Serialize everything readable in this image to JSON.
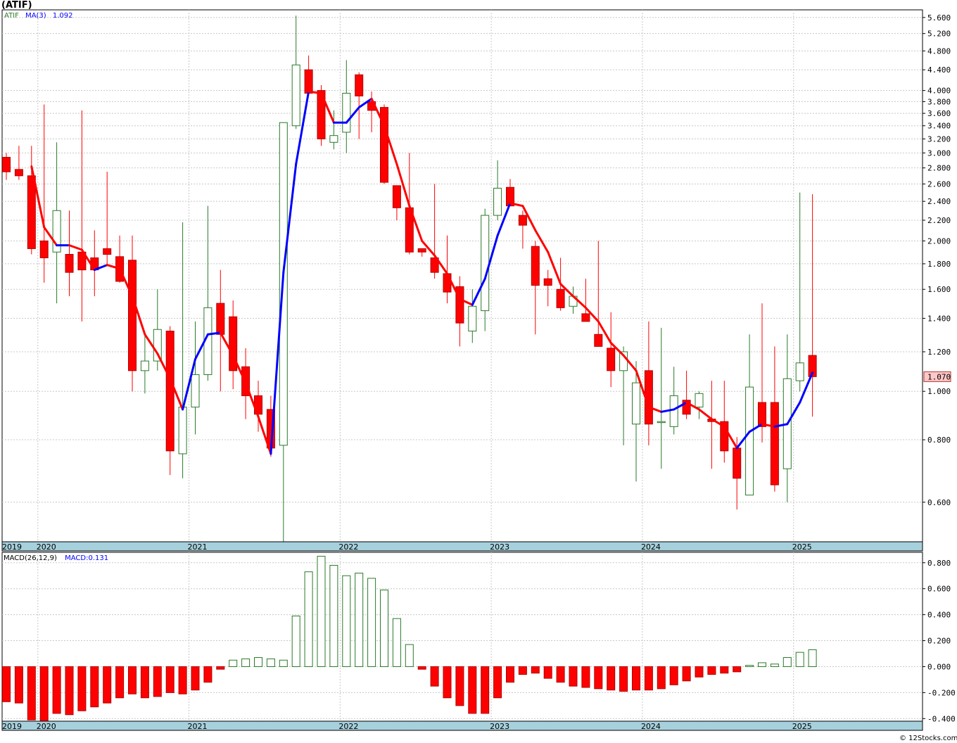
{
  "title": "(ATIF)",
  "footer": "© 12Stocks.com",
  "price_panel": {
    "ticker": "ATIF",
    "ma_label": "MA(3)",
    "ma_value": "1.092",
    "last_price": "1.070",
    "y_ticks": [
      {
        "v": 5.6,
        "label": "5.600"
      },
      {
        "v": 5.2,
        "label": "5.200"
      },
      {
        "v": 4.8,
        "label": "4.800"
      },
      {
        "v": 4.4,
        "label": "4.400"
      },
      {
        "v": 4.0,
        "label": "4.000"
      },
      {
        "v": 3.8,
        "label": "3.800"
      },
      {
        "v": 3.6,
        "label": "3.600"
      },
      {
        "v": 3.4,
        "label": "3.400"
      },
      {
        "v": 3.2,
        "label": "3.200"
      },
      {
        "v": 3.0,
        "label": "3.000"
      },
      {
        "v": 2.8,
        "label": "2.800"
      },
      {
        "v": 2.6,
        "label": "2.600"
      },
      {
        "v": 2.4,
        "label": "2.400"
      },
      {
        "v": 2.2,
        "label": "2.200"
      },
      {
        "v": 2.0,
        "label": "2.000"
      },
      {
        "v": 1.8,
        "label": "1.800"
      },
      {
        "v": 1.6,
        "label": "1.600"
      },
      {
        "v": 1.4,
        "label": "1.400"
      },
      {
        "v": 1.2,
        "label": "1.200"
      },
      {
        "v": 1.0,
        "label": "1.000"
      },
      {
        "v": 0.8,
        "label": "0.800"
      },
      {
        "v": 0.6,
        "label": "0.600"
      }
    ]
  },
  "macd_panel": {
    "label": "MACD(26,12,9)",
    "value_label": "MACD:0.131",
    "y_ticks": [
      {
        "v": 0.8,
        "label": "0.800"
      },
      {
        "v": 0.6,
        "label": "0.600"
      },
      {
        "v": 0.4,
        "label": "0.400"
      },
      {
        "v": 0.2,
        "label": "0.200"
      },
      {
        "v": 0.0,
        "label": "0.000"
      },
      {
        "v": -0.2,
        "label": "-0.200"
      },
      {
        "v": -0.4,
        "label": "-0.400"
      }
    ]
  },
  "colors": {
    "up": "#2a7a2a",
    "down": "#ff0000",
    "ma_up": "#0000ff",
    "ma_down": "#ff0000",
    "grid": "#c8c8c8",
    "axis_band": "#a6d0dc",
    "last_bg": "#ffc8c8"
  },
  "chart_data": {
    "type": "candlestick",
    "interval": "monthly",
    "scale": "log",
    "ylim": [
      0.5,
      5.8
    ],
    "macd_ylim": [
      -0.42,
      0.88
    ],
    "x_labels": [
      {
        "i": 0,
        "label": "2019"
      },
      {
        "i": 3,
        "label": "2020"
      },
      {
        "i": 15,
        "label": "2021"
      },
      {
        "i": 27,
        "label": "2022"
      },
      {
        "i": 39,
        "label": "2023"
      },
      {
        "i": 51,
        "label": "2024"
      },
      {
        "i": 63,
        "label": "2025"
      }
    ],
    "candles": [
      {
        "date": "2019-10",
        "o": 2.94,
        "h": 3.0,
        "l": 2.65,
        "c": 2.75
      },
      {
        "date": "2019-11",
        "o": 2.78,
        "h": 3.1,
        "l": 2.65,
        "c": 2.7
      },
      {
        "date": "2019-12",
        "o": 2.7,
        "h": 3.1,
        "l": 1.88,
        "c": 1.93
      },
      {
        "date": "2020-01",
        "o": 2.0,
        "h": 3.75,
        "l": 1.65,
        "c": 1.85
      },
      {
        "date": "2020-02",
        "o": 1.9,
        "h": 3.15,
        "l": 1.5,
        "c": 2.3
      },
      {
        "date": "2020-03",
        "o": 1.88,
        "h": 2.3,
        "l": 1.55,
        "c": 1.73
      },
      {
        "date": "2020-04",
        "o": 1.9,
        "h": 3.65,
        "l": 1.38,
        "c": 1.75
      },
      {
        "date": "2020-05",
        "o": 1.85,
        "h": 2.1,
        "l": 1.55,
        "c": 1.75
      },
      {
        "date": "2020-06",
        "o": 1.93,
        "h": 2.75,
        "l": 1.78,
        "c": 1.88
      },
      {
        "date": "2020-07",
        "o": 1.86,
        "h": 2.05,
        "l": 1.65,
        "c": 1.66
      },
      {
        "date": "2020-08",
        "o": 1.83,
        "h": 2.05,
        "l": 1.0,
        "c": 1.1
      },
      {
        "date": "2020-09",
        "o": 1.1,
        "h": 1.3,
        "l": 0.99,
        "c": 1.15
      },
      {
        "date": "2020-10",
        "o": 1.15,
        "h": 1.6,
        "l": 1.1,
        "c": 1.33
      },
      {
        "date": "2020-11",
        "o": 1.32,
        "h": 1.35,
        "l": 0.68,
        "c": 0.76
      },
      {
        "date": "2020-12",
        "o": 0.75,
        "h": 2.18,
        "l": 0.67,
        "c": 0.93
      },
      {
        "date": "2021-01",
        "o": 0.93,
        "h": 1.38,
        "l": 0.82,
        "c": 1.08
      },
      {
        "date": "2021-02",
        "o": 1.08,
        "h": 2.35,
        "l": 1.05,
        "c": 1.47
      },
      {
        "date": "2021-03",
        "o": 1.5,
        "h": 1.75,
        "l": 1.0,
        "c": 1.3
      },
      {
        "date": "2021-04",
        "o": 1.41,
        "h": 1.52,
        "l": 1.01,
        "c": 1.1
      },
      {
        "date": "2021-05",
        "o": 1.12,
        "h": 1.22,
        "l": 0.88,
        "c": 0.98
      },
      {
        "date": "2021-06",
        "o": 0.98,
        "h": 1.05,
        "l": 0.83,
        "c": 0.9
      },
      {
        "date": "2021-07",
        "o": 0.92,
        "h": 0.98,
        "l": 0.74,
        "c": 0.77
      },
      {
        "date": "2021-08",
        "o": 0.78,
        "h": 3.45,
        "l": 0.48,
        "c": 3.45
      },
      {
        "date": "2021-09",
        "o": 3.4,
        "h": 5.65,
        "l": 3.35,
        "c": 4.5
      },
      {
        "date": "2021-10",
        "o": 4.4,
        "h": 4.7,
        "l": 3.9,
        "c": 3.95
      },
      {
        "date": "2021-11",
        "o": 4.0,
        "h": 4.1,
        "l": 3.1,
        "c": 3.2
      },
      {
        "date": "2021-12",
        "o": 3.15,
        "h": 3.65,
        "l": 3.05,
        "c": 3.25
      },
      {
        "date": "2022-01",
        "o": 3.3,
        "h": 4.6,
        "l": 3.0,
        "c": 3.95
      },
      {
        "date": "2022-02",
        "o": 4.3,
        "h": 4.35,
        "l": 3.2,
        "c": 3.9
      },
      {
        "date": "2022-03",
        "o": 3.8,
        "h": 3.98,
        "l": 3.3,
        "c": 3.65
      },
      {
        "date": "2022-04",
        "o": 3.7,
        "h": 3.75,
        "l": 2.6,
        "c": 2.62
      },
      {
        "date": "2022-05",
        "o": 2.58,
        "h": 2.58,
        "l": 2.2,
        "c": 2.33
      },
      {
        "date": "2022-06",
        "o": 2.33,
        "h": 3.0,
        "l": 1.88,
        "c": 1.9
      },
      {
        "date": "2022-07",
        "o": 1.93,
        "h": 1.93,
        "l": 1.86,
        "c": 1.9
      },
      {
        "date": "2022-08",
        "o": 1.85,
        "h": 2.6,
        "l": 1.68,
        "c": 1.73
      },
      {
        "date": "2022-09",
        "o": 1.72,
        "h": 2.05,
        "l": 1.5,
        "c": 1.58
      },
      {
        "date": "2022-10",
        "o": 1.62,
        "h": 1.7,
        "l": 1.23,
        "c": 1.37
      },
      {
        "date": "2022-11",
        "o": 1.32,
        "h": 1.6,
        "l": 1.25,
        "c": 1.48
      },
      {
        "date": "2022-12",
        "o": 1.45,
        "h": 2.32,
        "l": 1.32,
        "c": 2.25
      },
      {
        "date": "2023-01",
        "o": 2.25,
        "h": 2.9,
        "l": 2.2,
        "c": 2.55
      },
      {
        "date": "2023-02",
        "o": 2.56,
        "h": 2.66,
        "l": 2.35,
        "c": 2.35
      },
      {
        "date": "2023-03",
        "o": 2.25,
        "h": 2.3,
        "l": 1.93,
        "c": 2.15
      },
      {
        "date": "2023-04",
        "o": 1.95,
        "h": 2.0,
        "l": 1.3,
        "c": 1.63
      },
      {
        "date": "2023-05",
        "o": 1.68,
        "h": 1.75,
        "l": 1.48,
        "c": 1.63
      },
      {
        "date": "2023-06",
        "o": 1.6,
        "h": 1.85,
        "l": 1.45,
        "c": 1.47
      },
      {
        "date": "2023-07",
        "o": 1.48,
        "h": 1.62,
        "l": 1.43,
        "c": 1.55
      },
      {
        "date": "2023-08",
        "o": 1.43,
        "h": 1.68,
        "l": 1.38,
        "c": 1.38
      },
      {
        "date": "2023-09",
        "o": 1.3,
        "h": 2.0,
        "l": 1.23,
        "c": 1.23
      },
      {
        "date": "2023-10",
        "o": 1.22,
        "h": 1.44,
        "l": 1.02,
        "c": 1.1
      },
      {
        "date": "2023-11",
        "o": 1.1,
        "h": 1.23,
        "l": 0.78,
        "c": 1.2
      },
      {
        "date": "2023-12",
        "o": 0.86,
        "h": 1.15,
        "l": 0.66,
        "c": 1.04
      },
      {
        "date": "2024-01",
        "o": 1.1,
        "h": 1.38,
        "l": 0.78,
        "c": 0.86
      },
      {
        "date": "2024-02",
        "o": 0.87,
        "h": 1.34,
        "l": 0.7,
        "c": 0.87
      },
      {
        "date": "2024-03",
        "o": 0.85,
        "h": 1.12,
        "l": 0.82,
        "c": 0.98
      },
      {
        "date": "2024-04",
        "o": 0.96,
        "h": 1.1,
        "l": 0.88,
        "c": 0.9
      },
      {
        "date": "2024-05",
        "o": 0.93,
        "h": 1.0,
        "l": 0.88,
        "c": 0.99
      },
      {
        "date": "2024-06",
        "o": 0.88,
        "h": 1.05,
        "l": 0.7,
        "c": 0.87
      },
      {
        "date": "2024-07",
        "o": 0.87,
        "h": 1.05,
        "l": 0.72,
        "c": 0.76
      },
      {
        "date": "2024-08",
        "o": 0.77,
        "h": 0.81,
        "l": 0.58,
        "c": 0.67
      },
      {
        "date": "2024-09",
        "o": 0.62,
        "h": 1.3,
        "l": 0.62,
        "c": 1.02
      },
      {
        "date": "2024-10",
        "o": 0.95,
        "h": 1.5,
        "l": 0.79,
        "c": 0.85
      },
      {
        "date": "2024-11",
        "o": 0.95,
        "h": 1.23,
        "l": 0.63,
        "c": 0.65
      },
      {
        "date": "2024-12",
        "o": 0.7,
        "h": 1.3,
        "l": 0.6,
        "c": 1.06
      },
      {
        "date": "2025-01",
        "o": 1.05,
        "h": 2.5,
        "l": 1.0,
        "c": 1.14
      },
      {
        "date": "2025-02",
        "o": 1.18,
        "h": 2.48,
        "l": 0.89,
        "c": 1.07
      }
    ],
    "ma": [
      null,
      null,
      2.82,
      2.13,
      1.96,
      1.96,
      1.92,
      1.75,
      1.79,
      1.76,
      1.55,
      1.3,
      1.19,
      1.06,
      0.92,
      1.16,
      1.3,
      1.31,
      1.18,
      1.04,
      0.89,
      0.75,
      1.73,
      2.85,
      3.98,
      3.95,
      3.45,
      3.45,
      3.7,
      3.85,
      3.4,
      2.85,
      2.35,
      2.0,
      1.87,
      1.72,
      1.53,
      1.49,
      1.68,
      2.05,
      2.38,
      2.35,
      2.1,
      1.9,
      1.64,
      1.55,
      1.47,
      1.38,
      1.25,
      1.18,
      1.1,
      0.93,
      0.91,
      0.92,
      0.95,
      0.92,
      0.88,
      0.85,
      0.77,
      0.83,
      0.86,
      0.85,
      0.86,
      0.95,
      1.09
    ],
    "macd": [
      -0.27,
      -0.28,
      -0.41,
      -0.42,
      -0.36,
      -0.37,
      -0.34,
      -0.31,
      -0.28,
      -0.24,
      -0.21,
      -0.24,
      -0.23,
      -0.2,
      -0.21,
      -0.18,
      -0.12,
      -0.02,
      0.05,
      0.06,
      0.07,
      0.06,
      0.05,
      0.39,
      0.73,
      0.85,
      0.78,
      0.7,
      0.72,
      0.68,
      0.59,
      0.37,
      0.17,
      -0.02,
      -0.15,
      -0.24,
      -0.3,
      -0.36,
      -0.36,
      -0.24,
      -0.12,
      -0.06,
      -0.05,
      -0.09,
      -0.12,
      -0.15,
      -0.16,
      -0.17,
      -0.18,
      -0.19,
      -0.18,
      -0.18,
      -0.17,
      -0.14,
      -0.11,
      -0.08,
      -0.06,
      -0.05,
      -0.04,
      0.01,
      0.03,
      0.02,
      0.07,
      0.11,
      0.13
    ]
  }
}
